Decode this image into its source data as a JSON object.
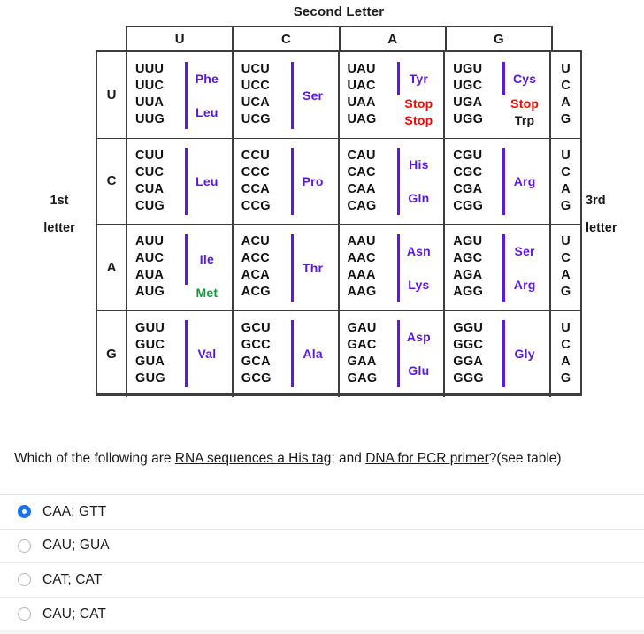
{
  "figure": {
    "second_letter_title": "Second Letter",
    "first_letter_label_line1": "1st",
    "first_letter_label_line2": "letter",
    "third_letter_label_line1": "3rd",
    "third_letter_label_line2": "letter",
    "second_letter_headers": [
      "U",
      "C",
      "A",
      "G"
    ],
    "colors": {
      "amino_acid": "#5a18e0",
      "stop": "#ff0000",
      "start_met": "#0d9a3c",
      "border": "#3d3d3d",
      "text": "#1a1a1a"
    },
    "rows": [
      {
        "first_letter": "U",
        "third_letters": [
          "U",
          "C",
          "A",
          "G"
        ],
        "blocks": [
          {
            "codons": [
              "UUU",
              "UUC",
              "UUA",
              "UUG"
            ],
            "groups": [
              {
                "label": "Phe",
                "span": 2,
                "start": 0,
                "color": "aa",
                "bar": true
              },
              {
                "label": "Leu",
                "span": 2,
                "start": 2,
                "color": "aa",
                "bar": true
              }
            ]
          },
          {
            "codons": [
              "UCU",
              "UCC",
              "UCA",
              "UCG"
            ],
            "groups": [
              {
                "label": "Ser",
                "span": 4,
                "start": 0,
                "color": "aa",
                "bar": true
              }
            ]
          },
          {
            "codons": [
              "UAU",
              "UAC",
              "UAA",
              "UAG"
            ],
            "groups": [
              {
                "label": "Tyr",
                "span": 2,
                "start": 0,
                "color": "aa",
                "bar": true
              },
              {
                "label": "Stop",
                "span": 1,
                "start": 2,
                "color": "stop",
                "bar": false
              },
              {
                "label": "Stop",
                "span": 1,
                "start": 3,
                "color": "stop",
                "bar": false
              }
            ]
          },
          {
            "codons": [
              "UGU",
              "UGC",
              "UGA",
              "UGG"
            ],
            "groups": [
              {
                "label": "Cys",
                "span": 2,
                "start": 0,
                "color": "aa",
                "bar": true
              },
              {
                "label": "Stop",
                "span": 1,
                "start": 2,
                "color": "stop",
                "bar": false
              },
              {
                "label": "Trp",
                "span": 1,
                "start": 3,
                "color": "trp",
                "bar": false
              }
            ]
          }
        ]
      },
      {
        "first_letter": "C",
        "third_letters": [
          "U",
          "C",
          "A",
          "G"
        ],
        "blocks": [
          {
            "codons": [
              "CUU",
              "CUC",
              "CUA",
              "CUG"
            ],
            "groups": [
              {
                "label": "Leu",
                "span": 4,
                "start": 0,
                "color": "aa",
                "bar": true
              }
            ]
          },
          {
            "codons": [
              "CCU",
              "CCC",
              "CCA",
              "CCG"
            ],
            "groups": [
              {
                "label": "Pro",
                "span": 4,
                "start": 0,
                "color": "aa",
                "bar": true
              }
            ]
          },
          {
            "codons": [
              "CAU",
              "CAC",
              "CAA",
              "CAG"
            ],
            "groups": [
              {
                "label": "His",
                "span": 2,
                "start": 0,
                "color": "aa",
                "bar": true
              },
              {
                "label": "Gln",
                "span": 2,
                "start": 2,
                "color": "aa",
                "bar": true
              }
            ]
          },
          {
            "codons": [
              "CGU",
              "CGC",
              "CGA",
              "CGG"
            ],
            "groups": [
              {
                "label": "Arg",
                "span": 4,
                "start": 0,
                "color": "aa",
                "bar": true
              }
            ]
          }
        ]
      },
      {
        "first_letter": "A",
        "third_letters": [
          "U",
          "C",
          "A",
          "G"
        ],
        "blocks": [
          {
            "codons": [
              "AUU",
              "AUC",
              "AUA",
              "AUG"
            ],
            "groups": [
              {
                "label": "Ile",
                "span": 3,
                "start": 0,
                "color": "aa",
                "bar": true
              },
              {
                "label": "Met",
                "span": 1,
                "start": 3,
                "color": "met",
                "bar": false
              }
            ]
          },
          {
            "codons": [
              "ACU",
              "ACC",
              "ACA",
              "ACG"
            ],
            "groups": [
              {
                "label": "Thr",
                "span": 4,
                "start": 0,
                "color": "aa",
                "bar": true
              }
            ]
          },
          {
            "codons": [
              "AAU",
              "AAC",
              "AAA",
              "AAG"
            ],
            "groups": [
              {
                "label": "Asn",
                "span": 2,
                "start": 0,
                "color": "aa",
                "bar": true
              },
              {
                "label": "Lys",
                "span": 2,
                "start": 2,
                "color": "aa",
                "bar": true
              }
            ]
          },
          {
            "codons": [
              "AGU",
              "AGC",
              "AGA",
              "AGG"
            ],
            "groups": [
              {
                "label": "Ser",
                "span": 2,
                "start": 0,
                "color": "aa",
                "bar": true
              },
              {
                "label": "Arg",
                "span": 2,
                "start": 2,
                "color": "aa",
                "bar": true
              }
            ]
          }
        ]
      },
      {
        "first_letter": "G",
        "third_letters": [
          "U",
          "C",
          "A",
          "G"
        ],
        "blocks": [
          {
            "codons": [
              "GUU",
              "GUC",
              "GUA",
              "GUG"
            ],
            "groups": [
              {
                "label": "Val",
                "span": 4,
                "start": 0,
                "color": "aa",
                "bar": true
              }
            ]
          },
          {
            "codons": [
              "GCU",
              "GCC",
              "GCA",
              "GCG"
            ],
            "groups": [
              {
                "label": "Ala",
                "span": 4,
                "start": 0,
                "color": "aa",
                "bar": true
              }
            ]
          },
          {
            "codons": [
              "GAU",
              "GAC",
              "GAA",
              "GAG"
            ],
            "groups": [
              {
                "label": "Asp",
                "span": 2,
                "start": 0,
                "color": "aa",
                "bar": true
              },
              {
                "label": "Glu",
                "span": 2,
                "start": 2,
                "color": "aa",
                "bar": true
              }
            ]
          },
          {
            "codons": [
              "GGU",
              "GGC",
              "GGA",
              "GGG"
            ],
            "groups": [
              {
                "label": "Gly",
                "span": 4,
                "start": 0,
                "color": "aa",
                "bar": true
              }
            ]
          }
        ]
      }
    ]
  },
  "question": {
    "segments": [
      {
        "text": "Which of the following are ",
        "underline": false
      },
      {
        "text": "RNA sequences a His tag",
        "underline": true
      },
      {
        "text": "; and ",
        "underline": false
      },
      {
        "text": "DNA for PCR primer",
        "underline": true
      },
      {
        "text": "?(see table)",
        "underline": false
      }
    ]
  },
  "answers": {
    "options": [
      {
        "label": "CAA; GTT",
        "selected": true
      },
      {
        "label": "CAU; GUA",
        "selected": false
      },
      {
        "label": "CAT; CAT",
        "selected": false
      },
      {
        "label": "CAU; CAT",
        "selected": false
      }
    ]
  }
}
